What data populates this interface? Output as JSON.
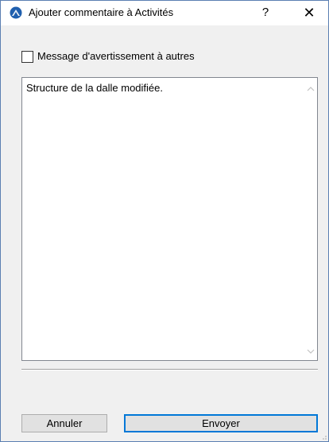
{
  "window": {
    "title": "Ajouter commentaire à Activités",
    "help_label": "?",
    "close_label": "✕"
  },
  "checkbox": {
    "label": "Message d'avertissement à autres",
    "checked": false
  },
  "comment": {
    "value": "Structure de la dalle modifiée."
  },
  "buttons": {
    "cancel_label": "Annuler",
    "send_label": "Envoyer"
  },
  "colors": {
    "accent": "#0078d7",
    "app_icon": "#1f5fae"
  },
  "icons": {
    "app": "archicad-logo-icon",
    "scroll_up": "chevron-up-icon",
    "scroll_down": "chevron-down-icon",
    "resize": "resize-grip-icon"
  }
}
